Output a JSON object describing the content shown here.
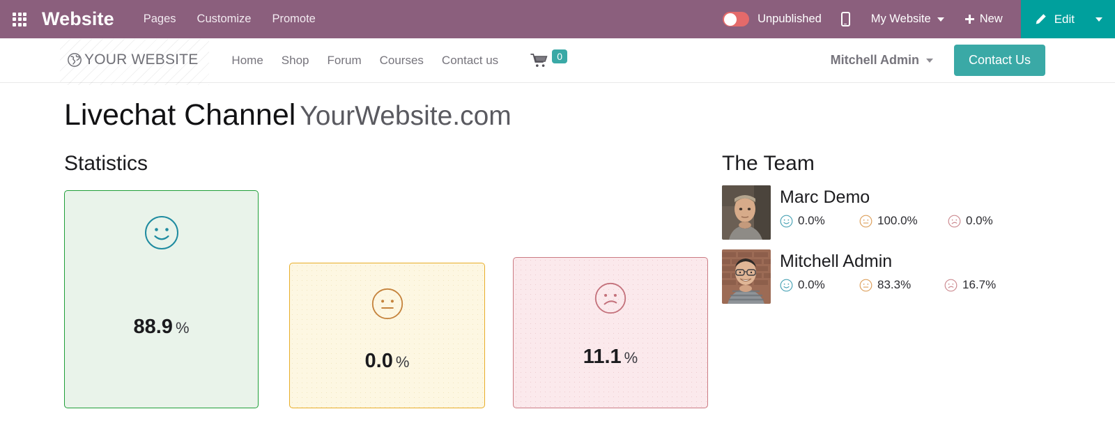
{
  "odoo_bar": {
    "apps_icon": "apps-grid-icon",
    "brand": "Website",
    "menu": [
      {
        "label": "Pages"
      },
      {
        "label": "Customize"
      },
      {
        "label": "Promote"
      }
    ],
    "publish_toggle": {
      "state": "off",
      "label": "Unpublished",
      "color": "#e46a6a"
    },
    "mobile_preview_icon": "mobile-phone-icon",
    "site_selector": {
      "label": "My Website",
      "caret": "chevron-down-icon"
    },
    "new_button": {
      "label": "New",
      "icon": "plus-icon"
    },
    "edit_button": {
      "label": "Edit",
      "icon": "pencil-icon",
      "color": "#00a09d"
    },
    "edit_caret_icon": "chevron-down-icon"
  },
  "site_nav": {
    "logo": {
      "icon": "globe-icon",
      "text": "YOUR WEBSITE"
    },
    "links": [
      {
        "label": "Home"
      },
      {
        "label": "Shop"
      },
      {
        "label": "Forum"
      },
      {
        "label": "Courses"
      },
      {
        "label": "Contact us"
      }
    ],
    "cart": {
      "icon": "shopping-cart-icon",
      "count": "0",
      "badge_color": "#3aa9a6"
    },
    "user_menu": {
      "label": "Mitchell Admin",
      "caret": "chevron-down-icon"
    },
    "cta": {
      "label": "Contact Us",
      "color": "#3aa9a6"
    }
  },
  "page": {
    "title": "Livechat Channel",
    "domain": "YourWebsite.com",
    "statistics_heading": "Statistics",
    "team_heading": "The Team"
  },
  "chart_data": {
    "type": "bar",
    "title": "Statistics",
    "categories": [
      "Happy",
      "Neutral",
      "Unhappy"
    ],
    "values": [
      88.9,
      0.0,
      11.1
    ],
    "unit": "%",
    "ylim": [
      0,
      100
    ],
    "grid": false,
    "legend": "none",
    "xlabel": "",
    "ylabel": ""
  },
  "statistics": {
    "cards": [
      {
        "key": "happy",
        "face": "smiley-happy-icon",
        "value": "88.9",
        "percent_symbol": "%",
        "bg": "#e9f3ea",
        "border": "#1f9e38",
        "face_color": "#1f8ba0"
      },
      {
        "key": "neutral",
        "face": "smiley-neutral-icon",
        "value": "0.0",
        "percent_symbol": "%",
        "bg": "#fdf7e2",
        "border": "#e8ad27",
        "face_color": "#c5833c"
      },
      {
        "key": "unhappy",
        "face": "smiley-sad-icon",
        "value": "11.1",
        "percent_symbol": "%",
        "bg": "#fbe9ec",
        "border": "#cb7a82",
        "face_color": "#c4727c"
      }
    ]
  },
  "team": {
    "members": [
      {
        "name": "Marc Demo",
        "avatar": "avatar-marc-demo",
        "stats": [
          {
            "icon": "smiley-happy-icon",
            "value": "0.0%",
            "color": "#4aa3b5"
          },
          {
            "icon": "smiley-neutral-icon",
            "value": "100.0%",
            "color": "#dda05c"
          },
          {
            "icon": "smiley-sad-icon",
            "value": "0.0%",
            "color": "#cc8a90"
          }
        ]
      },
      {
        "name": "Mitchell Admin",
        "avatar": "avatar-mitchell-admin",
        "stats": [
          {
            "icon": "smiley-happy-icon",
            "value": "0.0%",
            "color": "#4aa3b5"
          },
          {
            "icon": "smiley-neutral-icon",
            "value": "83.3%",
            "color": "#dda05c"
          },
          {
            "icon": "smiley-sad-icon",
            "value": "16.7%",
            "color": "#cc8a90"
          }
        ]
      }
    ]
  }
}
